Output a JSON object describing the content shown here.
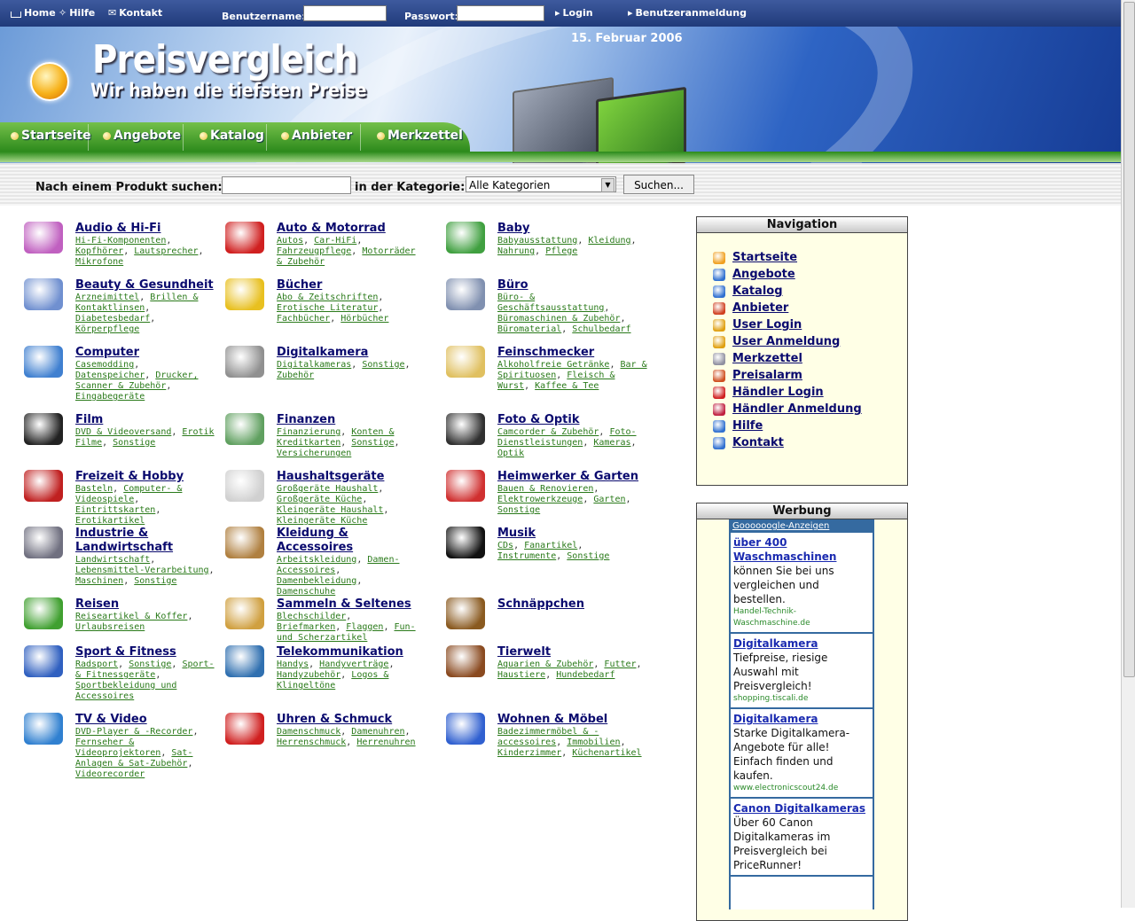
{
  "topbar": {
    "home": "Home",
    "help": "Hilfe",
    "contact": "Kontakt",
    "username_label": "Benutzername:",
    "password_label": "Passwort:",
    "login": "Login",
    "register": "Benutzeranmeldung"
  },
  "banner": {
    "title": "Preisvergleich",
    "subtitle": "Wir haben die tiefsten Preise",
    "date": "15. Februar 2006"
  },
  "nav_tabs": [
    "Startseite",
    "Angebote",
    "Katalog",
    "Anbieter",
    "Merkzettel"
  ],
  "search": {
    "label": "Nach einem Produkt suchen:",
    "category_label": "in der Kategorie:",
    "category_value": "Alle Kategorien",
    "button": "Suchen..."
  },
  "categories": [
    {
      "title": "Audio & Hi-Fi",
      "subs": [
        "Hi-Fi-Komponenten",
        "Kopfhörer",
        "Lautsprecher",
        "Mikrofone"
      ],
      "icon": "tv-icon",
      "color": "#c060c0"
    },
    {
      "title": "Auto & Motorrad",
      "subs": [
        "Autos",
        "Car-HiFi",
        "Fahrzeugpflege",
        "Motorräder & Zubehör"
      ],
      "icon": "race-car-icon",
      "color": "#d02020"
    },
    {
      "title": "Baby",
      "subs": [
        "Babyausstattung",
        "Kleidung",
        "Nahrung",
        "Pflege"
      ],
      "icon": "toy-train-icon",
      "color": "#40a040"
    },
    {
      "title": "Beauty & Gesundheit",
      "subs": [
        "Arzneimittel",
        "Brillen & Kontaktlinsen",
        "Diabetesbedarf",
        "Körperpflege"
      ],
      "icon": "pills-icon",
      "color": "#7090d0"
    },
    {
      "title": "Bücher",
      "subs": [
        "Abo & Zeitschriften",
        "Erotische Literatur",
        "Fachbücher",
        "Hörbücher"
      ],
      "icon": "book-icon",
      "color": "#e8c020"
    },
    {
      "title": "Büro",
      "subs": [
        "Büro- & Geschäftsausstattung",
        "Büromaschinen & Zubehör",
        "Büromaterial",
        "Schulbedarf"
      ],
      "icon": "mousepad-icon",
      "color": "#8090b0"
    },
    {
      "title": "Computer",
      "subs": [
        "Casemodding",
        "Datenspeicher",
        "Drucker, Scanner & Zubehör",
        "Eingabegeräte"
      ],
      "icon": "computer-icon",
      "color": "#4080d0"
    },
    {
      "title": "Digitalkamera",
      "subs": [
        "Digitalkameras",
        "Sonstige",
        "Zubehör"
      ],
      "icon": "camcorder-icon",
      "color": "#909090"
    },
    {
      "title": "Feinschmecker",
      "subs": [
        "Alkoholfreie Getränke",
        "Bar & Spirituosen",
        "Fleisch & Wurst",
        "Kaffee & Tee"
      ],
      "icon": "champagne-icon",
      "color": "#e0c060"
    },
    {
      "title": "Film",
      "subs": [
        "DVD & Videoversand",
        "Erotik Filme",
        "Sonstige"
      ],
      "icon": "clapperboard-icon",
      "color": "#222222"
    },
    {
      "title": "Finanzen",
      "subs": [
        "Finanzierung",
        "Konten & Kreditkarten",
        "Sonstige",
        "Versicherungen"
      ],
      "icon": "money-icon",
      "color": "#60a060"
    },
    {
      "title": "Foto & Optik",
      "subs": [
        "Camcorder & Zubehör",
        "Foto-Dienstleistungen",
        "Kameras",
        "Optik"
      ],
      "icon": "camera-icon",
      "color": "#303030"
    },
    {
      "title": "Freizeit & Hobby",
      "subs": [
        "Basteln",
        "Computer- & Videospiele",
        "Eintrittskarten",
        "Erotikartikel"
      ],
      "icon": "dartboard-icon",
      "color": "#c02020"
    },
    {
      "title": "Haushaltsgeräte",
      "subs": [
        "Großgeräte Haushalt",
        "Großgeräte Küche",
        "Kleingeräte Haushalt",
        "Kleingeräte Küche"
      ],
      "icon": "washing-machine-icon",
      "color": "#d0d0d0"
    },
    {
      "title": "Heimwerker & Garten",
      "subs": [
        "Bauen & Renovieren",
        "Elektrowerkzeuge",
        "Garten",
        "Sonstige"
      ],
      "icon": "chainsaw-icon",
      "color": "#d03030"
    },
    {
      "title": "Industrie & Landwirtschaft",
      "subs": [
        "Landwirtschaft",
        "Lebensmittel-Verarbeitung",
        "Maschinen",
        "Sonstige"
      ],
      "icon": "screw-icon",
      "color": "#707080"
    },
    {
      "title": "Kleidung & Accessoires",
      "subs": [
        "Arbeitskleidung",
        "Damen-Accessoires",
        "Damenbekleidung",
        "Damenschuhe"
      ],
      "icon": "hanger-icon",
      "color": "#b08040"
    },
    {
      "title": "Musik",
      "subs": [
        "CDs",
        "Fanartikel",
        "Instrumente",
        "Sonstige"
      ],
      "icon": "piano-icon",
      "color": "#111111"
    },
    {
      "title": "Reisen",
      "subs": [
        "Reiseartikel & Koffer",
        "Urlaubsreisen"
      ],
      "icon": "palm-tree-icon",
      "color": "#40a030"
    },
    {
      "title": "Sammeln & Seltenes",
      "subs": [
        "Blechschilder",
        "Briefmarken",
        "Flaggen",
        "Fun- und Scherzartikel"
      ],
      "icon": "picture-frame-icon",
      "color": "#d0a040"
    },
    {
      "title": "Schnäppchen",
      "subs": [],
      "icon": "pot-icon",
      "color": "#8a5a20"
    },
    {
      "title": "Sport & Fitness",
      "subs": [
        "Radsport",
        "Sonstige",
        "Sport- & Fitnessgeräte",
        "Sportbekleidung und Accessoires"
      ],
      "icon": "tennis-racket-icon",
      "color": "#3060c0"
    },
    {
      "title": "Telekommunikation",
      "subs": [
        "Handys",
        "Handyverträge",
        "Handyzubehör",
        "Logos & Klingeltöne"
      ],
      "icon": "telephone-icon",
      "color": "#3070b0"
    },
    {
      "title": "Tierwelt",
      "subs": [
        "Aquarien & Zubehör",
        "Futter",
        "Haustiere",
        "Hundebedarf"
      ],
      "icon": "horse-icon",
      "color": "#8a4a20"
    },
    {
      "title": "TV & Video",
      "subs": [
        "DVD-Player & -Recorder",
        "Fernseher & Videoprojektoren",
        "Sat-Anlagen & Sat-Zubehör",
        "Videorecorder"
      ],
      "icon": "projector-icon",
      "color": "#3080d0"
    },
    {
      "title": "Uhren & Schmuck",
      "subs": [
        "Damenschmuck",
        "Damenuhren",
        "Herrenschmuck",
        "Herrenuhren"
      ],
      "icon": "alarm-clock-icon",
      "color": "#d02020"
    },
    {
      "title": "Wohnen & Möbel",
      "subs": [
        "Badezimmermöbel & -accessoires",
        "Immobilien",
        "Kinderzimmer",
        "Küchenartikel"
      ],
      "icon": "sofa-icon",
      "color": "#3060d0"
    }
  ],
  "navigation": {
    "title": "Navigation",
    "items": [
      {
        "label": "Startseite",
        "icon": "home-icon",
        "color": "#f0a020"
      },
      {
        "label": "Angebote",
        "icon": "offers-icon",
        "color": "#3070d0"
      },
      {
        "label": "Katalog",
        "icon": "monitor-icon",
        "color": "#3070d0"
      },
      {
        "label": "Anbieter",
        "icon": "lifebuoy-icon",
        "color": "#d04020"
      },
      {
        "label": "User Login",
        "icon": "key-icon",
        "color": "#e0a010"
      },
      {
        "label": "User Anmeldung",
        "icon": "register-arrow-icon",
        "color": "#e0a010"
      },
      {
        "label": "Merkzettel",
        "icon": "notepad-icon",
        "color": "#9090a0"
      },
      {
        "label": "Preisalarm",
        "icon": "alarm-person-icon",
        "color": "#d05020"
      },
      {
        "label": "Händler Login",
        "icon": "dealer-login-icon",
        "color": "#d02020"
      },
      {
        "label": "Händler Anmeldung",
        "icon": "dealer-register-icon",
        "color": "#c02040"
      },
      {
        "label": "Hilfe",
        "icon": "help-icon",
        "color": "#3070d0"
      },
      {
        "label": "Kontakt",
        "icon": "contact-icon",
        "color": "#3070d0"
      }
    ]
  },
  "ads": {
    "title": "Werbung",
    "header": "Goooooogle-Anzeigen",
    "items": [
      {
        "title": "über 400 Waschmaschinen",
        "desc": "können Sie bei uns vergleichen und bestellen.",
        "url": "Handel-Technik-Waschmaschine.de"
      },
      {
        "title": "Digitalkamera",
        "desc": "Tiefpreise, riesige Auswahl mit Preisvergleich!",
        "url": "shopping.tiscali.de"
      },
      {
        "title": "Digitalkamera",
        "desc": "Starke Digitalkamera-Angebote für alle! Einfach finden und kaufen.",
        "url": "www.electronicscout24.de"
      },
      {
        "title": "Canon Digitalkameras",
        "desc": "Über 60 Canon Digitalkameras im Preisvergleich bei PriceRunner!",
        "url": ""
      }
    ]
  }
}
